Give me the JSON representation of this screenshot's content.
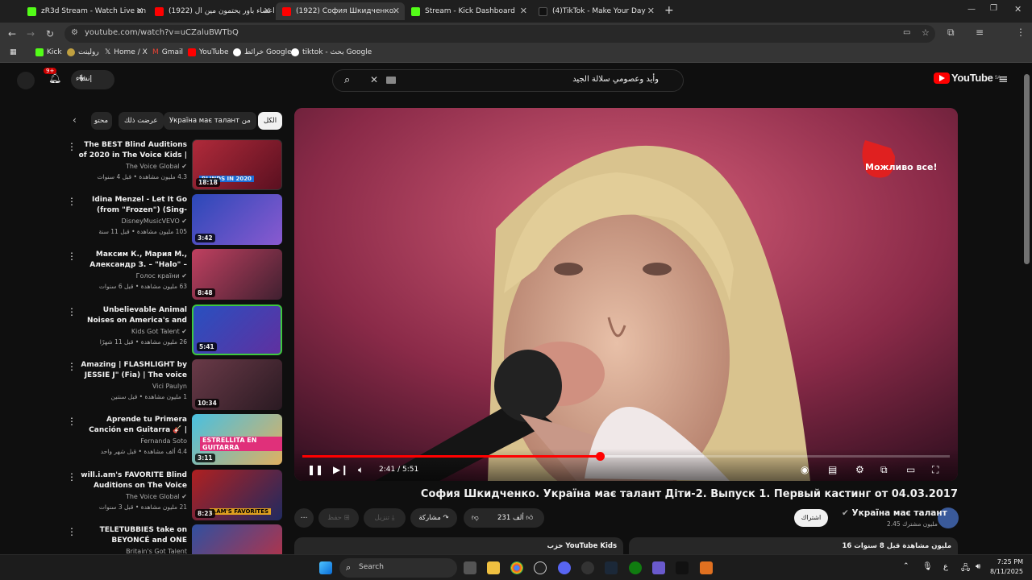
{
  "browser": {
    "tabs": [
      {
        "title": "zR3d Stream - Watch Live on Ki",
        "color": "#53fc18"
      },
      {
        "title": "(1922) اعضاء باور يحتمون مين ال",
        "color": "#ff0000"
      },
      {
        "title": "(1922) София Шкидченко.",
        "color": "#ff0000"
      },
      {
        "title": "Stream - Kick Dashboard",
        "color": "#53fc18"
      },
      {
        "title": "(4)TikTok - Make Your Day",
        "color": "#111111"
      }
    ],
    "new_tab": "+",
    "url": "youtube.com/watch?v=uCZaluBWTbQ",
    "bookmarks": [
      "Kick",
      "رولينت",
      "Home / X",
      "Gmail",
      "YouTube",
      "خرائط Google",
      "tiktok - بحث Google"
    ]
  },
  "youtube": {
    "create_label": "إنشاء",
    "notif_count": "9+",
    "search_query": "وأيد وعصومي سلالة الجيد",
    "logo_text": "YouTube",
    "logo_region": "SA",
    "chips": [
      "الكل",
      "Україна має талант من",
      "عرضت ذلك",
      "محتو"
    ],
    "recommendations": [
      {
        "title": "The BEST Blind Auditions of 2020 in The Voice Kids | The ...",
        "channel": "The Voice Global",
        "meta": "4.3 مليون مشاهدة • قبل 4 سنوات",
        "duration": "18:18",
        "thumb": "#9a2030"
      },
      {
        "title": "Idina Menzel - Let It Go (from \"Frozen\") (Sing-Along Version)",
        "channel": "DisneyMusicVEVO",
        "meta": "105 مليون مشاهدة • قبل 11 سنة",
        "duration": "3:42",
        "thumb": "#3050b0"
      },
      {
        "title": "Максим К., Мария М., Александр З. – \"Halo\" – бои –...",
        "channel": "Голос країни",
        "meta": "63 مليون مشاهدة • قبل 6 سنوات",
        "duration": "8:48",
        "thumb": "#b03050"
      },
      {
        "title": "Unbelievable Animal Noises on America's and Britain's Got ...",
        "channel": "Kids Got Talent",
        "meta": "26 مليون مشاهدة • قبل 11 شهرًا",
        "duration": "5:41",
        "thumb": "#3060c0"
      },
      {
        "title": "Amazing | FLASHLIGHT by JESSIE J\" (Fia) | The voice kids...",
        "channel": "Vici Paulyn",
        "meta": "1 مليون مشاهدة • قبل سنتين",
        "duration": "10:34",
        "thumb": "#704050"
      },
      {
        "title": "Aprende tu Primera Canción en Guitarra 🎸 | Tutorial FÁCIL para...",
        "channel": "Fernanda Soto",
        "meta": "4.4 ألف مشاهدة • قبل شهر واحد",
        "duration": "3:11",
        "thumb": "#40b0d0"
      },
      {
        "title": "will.i.am's FAVORITE Blind Auditions on The Voice Kids UK",
        "channel": "The Voice Global",
        "meta": "21 مليون مشاهدة • قبل 3 سنوات",
        "duration": "8:23",
        "thumb": "#a02020"
      },
      {
        "title": "TELETUBBIES take on BEYONCÉ and ONE DIRECTION!...",
        "channel": "Britain's Got Talent",
        "meta": "",
        "duration": "",
        "thumb": "#304080"
      }
    ],
    "player": {
      "watermark": "Можливо все!",
      "time_current": "2:41",
      "time_total": "5:51",
      "progress": 0.459,
      "buffered": 0.62
    },
    "video_title": "София Шкидченко. Україна має талант Діти-2. Выпуск 1. Первый кастинг от 04.03.2017",
    "channel_name": "Україна має талант",
    "channel_subs": "2.45 مليون مشترك",
    "subscribe_label": "اشتراك",
    "likes": "231 ألف",
    "share_label": "مشاركة",
    "download_label": "تنزيل",
    "save_label": "حفظ",
    "desc_views": "16 مليون مشاهدة قبل 8 سنوات",
    "desc_playlist": "حزب YouTube Kids"
  },
  "taskbar": {
    "search_label": "Search",
    "time": "7:25 PM",
    "date": "8/11/2025",
    "lang": "ع"
  }
}
